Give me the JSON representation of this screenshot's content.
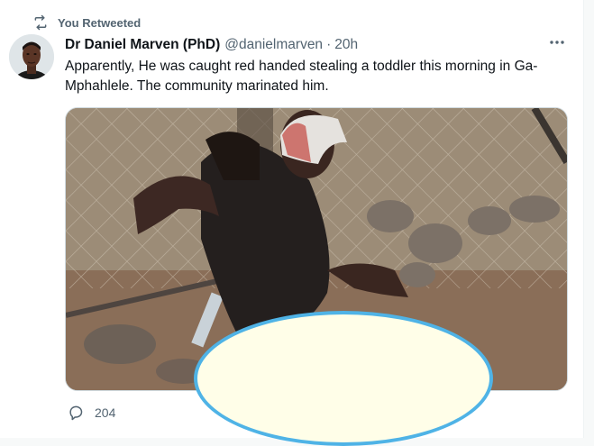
{
  "social_context": {
    "text": "You Retweeted",
    "icon": "retweet-icon"
  },
  "tweet": {
    "display_name": "Dr Daniel Marven (PhD)",
    "handle": "@danielmarven",
    "separator": "·",
    "time": "20h",
    "text": "Apparently, He was caught red handed stealing a toddler this morning in Ga-Mphahlele. The community marinated him.",
    "more_icon": "more-icon"
  },
  "actions": {
    "reply_count": "204",
    "reply_icon": "reply-icon"
  },
  "colors": {
    "text_primary": "#0f1419",
    "text_secondary": "#536471",
    "censor_fill": "#fffee8",
    "censor_border": "#4fb3e6"
  }
}
